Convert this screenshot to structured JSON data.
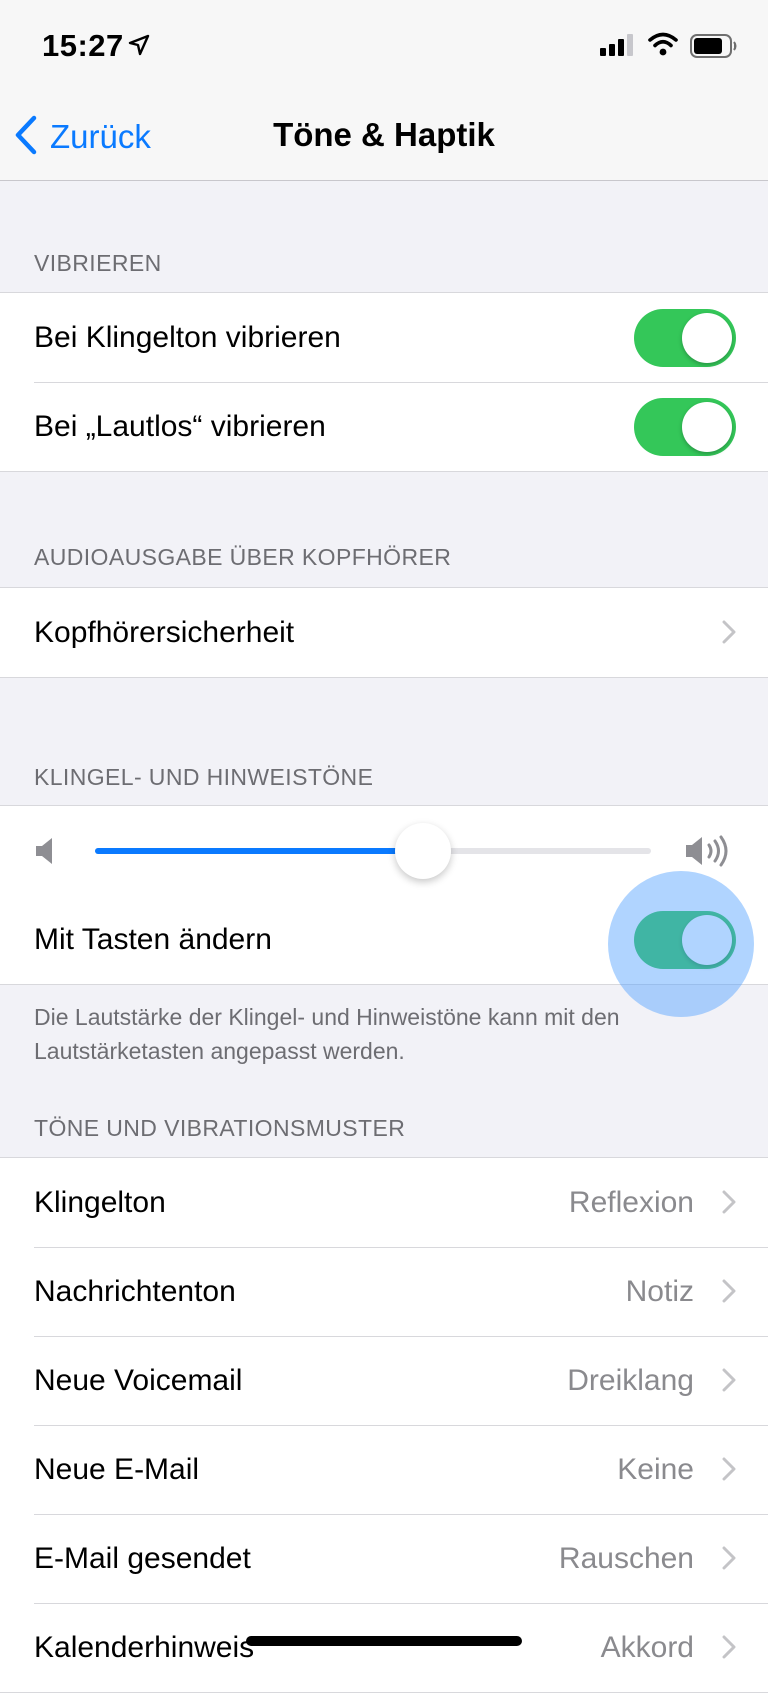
{
  "status_bar": {
    "time": "15:27",
    "location_icon": "location-arrow-icon",
    "signal_icon": "cellular-signal-icon",
    "wifi_icon": "wifi-icon",
    "battery_icon": "battery-icon"
  },
  "nav": {
    "back_label": "Zurück",
    "back_icon": "chevron-left-icon",
    "title": "Töne & Haptik"
  },
  "sections": {
    "vibrieren": {
      "header": "VIBRIEREN",
      "rows": [
        {
          "label": "Bei Klingelton vibrieren",
          "on": true
        },
        {
          "label": "Bei „Lautlos“ vibrieren",
          "on": true
        }
      ]
    },
    "audio": {
      "header": "AUDIOAUSGABE ÜBER KOPFHÖRER",
      "rows": [
        {
          "label": "Kopfhörersicherheit"
        }
      ]
    },
    "klingel": {
      "header": "KLINGEL- UND HINWEISTÖNE",
      "volume": {
        "level": 0.59,
        "low_icon": "speaker-low-icon",
        "high_icon": "speaker-high-icon"
      },
      "toggle_row": {
        "label": "Mit Tasten ändern",
        "on": true
      },
      "footer": "Die Lautstärke der Klingel- und Hinweistöne kann mit den Lautstärketasten angepasst werden."
    },
    "toene": {
      "header": "TÖNE UND VIBRATIONSMUSTER",
      "rows": [
        {
          "label": "Klingelton",
          "value": "Reflexion"
        },
        {
          "label": "Nachrichtenton",
          "value": "Notiz"
        },
        {
          "label": "Neue Voicemail",
          "value": "Dreiklang"
        },
        {
          "label": "Neue E-Mail",
          "value": "Keine"
        },
        {
          "label": "E-Mail gesendet",
          "value": "Rauschen"
        },
        {
          "label": "Kalenderhinweis",
          "value": "Akkord"
        }
      ]
    }
  },
  "colors": {
    "accent": "#0a7aff",
    "toggle_on": "#34c759",
    "background": "#f2f2f7",
    "secondary_text": "#8a8a8e"
  }
}
